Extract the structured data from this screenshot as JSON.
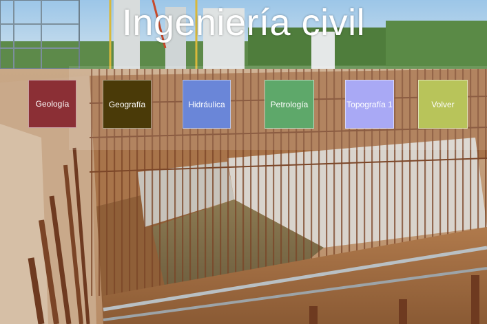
{
  "title": "Ingeniería civil",
  "menu": [
    {
      "label": "Geología",
      "color": "#8b2f35"
    },
    {
      "label": "Geografía",
      "color": "#4a3a08"
    },
    {
      "label": "Hidráulica",
      "color": "#6a86d8"
    },
    {
      "label": "Petrología",
      "color": "#5ea86a"
    },
    {
      "label": "Topografía 1",
      "color": "#a9a9f5"
    },
    {
      "label": "Volver",
      "color": "#b8c45a"
    }
  ],
  "background": {
    "subject": "construction-site-rebar-photo"
  }
}
